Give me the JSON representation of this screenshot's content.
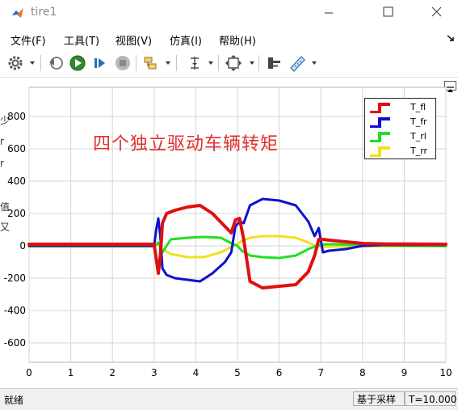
{
  "window": {
    "title": "tire1",
    "icon": "matlab-icon"
  },
  "menu": {
    "items": [
      "文件(F)",
      "工具(T)",
      "视图(V)",
      "仿真(I)",
      "帮助(H)"
    ]
  },
  "toolbar": {
    "icons": [
      "settings-gear-icon",
      "step-back-icon",
      "run-icon",
      "step-forward-icon",
      "stop-icon",
      "signal-selector-icon",
      "cursor-measure-icon",
      "zoom-fit-icon",
      "style-icon",
      "ruler-icon"
    ]
  },
  "background_fragments": [
    "少",
    "r",
    "r",
    "值",
    "又"
  ],
  "chart_data": {
    "type": "line",
    "title": "四个独立驱动车辆转矩",
    "xlim": [
      0,
      10
    ],
    "ylim": [
      -720,
      980
    ],
    "xticks": [
      "0",
      "1",
      "2",
      "3",
      "4",
      "5",
      "6",
      "7",
      "8",
      "9",
      "10"
    ],
    "yticks": [
      "800",
      "600",
      "400",
      "200",
      "0",
      "-200",
      "-400",
      "-600"
    ],
    "grid": true,
    "legend_position": "top-right",
    "series": [
      {
        "name": "T_fl",
        "color": "#e01010",
        "x": [
          0,
          3.0,
          3.05,
          3.1,
          3.15,
          3.2,
          3.3,
          3.5,
          3.8,
          4.1,
          4.4,
          4.7,
          4.85,
          4.95,
          5.05,
          5.15,
          5.3,
          5.6,
          6.0,
          6.4,
          6.7,
          6.85,
          6.95,
          7.05,
          7.2,
          7.6,
          8.0,
          8.5,
          10
        ],
        "y": [
          10,
          10,
          -80,
          -170,
          -60,
          140,
          200,
          220,
          240,
          250,
          200,
          120,
          80,
          160,
          170,
          40,
          -220,
          -260,
          -250,
          -240,
          -160,
          -60,
          40,
          40,
          35,
          25,
          15,
          12,
          10
        ]
      },
      {
        "name": "T_fr",
        "color": "#1010d0",
        "x": [
          0,
          3.0,
          3.05,
          3.1,
          3.15,
          3.2,
          3.3,
          3.5,
          3.8,
          4.1,
          4.4,
          4.7,
          4.85,
          4.95,
          5.05,
          5.15,
          5.3,
          5.6,
          6.0,
          6.4,
          6.7,
          6.85,
          6.95,
          7.05,
          7.2,
          7.6,
          8.0,
          8.5,
          10
        ],
        "y": [
          0,
          0,
          100,
          170,
          60,
          -140,
          -180,
          -200,
          -210,
          -220,
          -170,
          -100,
          -40,
          120,
          150,
          140,
          250,
          290,
          280,
          250,
          150,
          60,
          110,
          -40,
          -30,
          -20,
          0,
          5,
          5
        ]
      },
      {
        "name": "T_rl",
        "color": "#20e020",
        "x": [
          0,
          3.0,
          3.1,
          3.2,
          3.4,
          3.8,
          4.2,
          4.6,
          4.9,
          5.0,
          5.1,
          5.3,
          5.6,
          6.0,
          6.4,
          6.7,
          6.9,
          7.0,
          7.1,
          7.3,
          8.0,
          10
        ],
        "y": [
          0,
          0,
          20,
          -40,
          40,
          50,
          55,
          50,
          10,
          0,
          -30,
          -60,
          -70,
          -75,
          -60,
          -20,
          0,
          5,
          10,
          10,
          5,
          0
        ],
        "y_note": "",
        "spikes": []
      },
      {
        "name": "T_rr",
        "color": "#f0e020",
        "x": [
          0,
          3.0,
          3.1,
          3.2,
          3.4,
          3.8,
          4.2,
          4.6,
          4.9,
          5.0,
          5.1,
          5.3,
          5.6,
          6.0,
          6.4,
          6.7,
          6.9,
          7.0,
          7.1,
          7.3,
          8.0,
          10
        ],
        "y": [
          -5,
          -5,
          10,
          -20,
          -50,
          -70,
          -70,
          -40,
          0,
          10,
          30,
          50,
          60,
          60,
          50,
          20,
          0,
          -5,
          -5,
          -5,
          -3,
          -3
        ]
      }
    ]
  },
  "status": {
    "left": "就绪",
    "mode": "基于采样",
    "time": "T=10.000"
  }
}
